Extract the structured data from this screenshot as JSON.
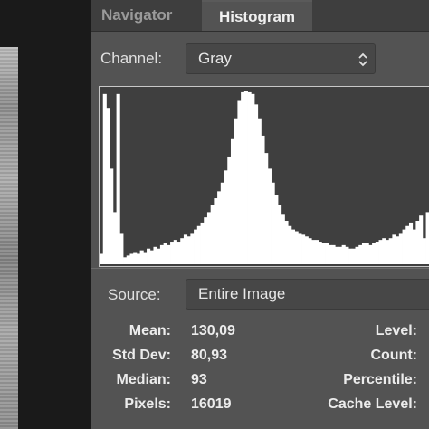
{
  "tabs": [
    {
      "label": "Navigator",
      "active": false
    },
    {
      "label": "Histogram",
      "active": true
    }
  ],
  "channel": {
    "label": "Channel:",
    "value": "Gray"
  },
  "source": {
    "label": "Source:",
    "value": "Entire Image"
  },
  "stats_left": [
    {
      "label": "Mean:",
      "value": "130,09"
    },
    {
      "label": "Std Dev:",
      "value": "80,93"
    },
    {
      "label": "Median:",
      "value": "93"
    },
    {
      "label": "Pixels:",
      "value": "16019"
    }
  ],
  "stats_right": [
    {
      "label": "Level:"
    },
    {
      "label": "Count:"
    },
    {
      "label": "Percentile:"
    },
    {
      "label": "Cache Level:"
    }
  ],
  "colors": {
    "panel": "#535353",
    "tabbar": "#3e3e3e",
    "histogram_bg": "#3f3f3f",
    "histogram_fill": "#ffffff",
    "text": "#ececec"
  },
  "histogram_levels": [
    0.06,
    0.98,
    0.9,
    0.55,
    0.3,
    0.98,
    0.18,
    0.04,
    0.05,
    0.06,
    0.07,
    0.06,
    0.08,
    0.07,
    0.09,
    0.08,
    0.1,
    0.09,
    0.11,
    0.12,
    0.11,
    0.13,
    0.14,
    0.13,
    0.15,
    0.17,
    0.16,
    0.18,
    0.2,
    0.22,
    0.24,
    0.27,
    0.3,
    0.34,
    0.38,
    0.42,
    0.47,
    0.54,
    0.62,
    0.72,
    0.84,
    0.94,
    0.99,
    1.0,
    0.99,
    0.98,
    0.92,
    0.84,
    0.74,
    0.64,
    0.55,
    0.47,
    0.4,
    0.34,
    0.29,
    0.25,
    0.22,
    0.2,
    0.19,
    0.18,
    0.17,
    0.16,
    0.15,
    0.14,
    0.14,
    0.13,
    0.12,
    0.12,
    0.11,
    0.11,
    0.1,
    0.1,
    0.11,
    0.1,
    0.09,
    0.09,
    0.1,
    0.11,
    0.12,
    0.12,
    0.11,
    0.12,
    0.13,
    0.14,
    0.15,
    0.14,
    0.15,
    0.17,
    0.16,
    0.18,
    0.2,
    0.22,
    0.24,
    0.2,
    0.25,
    0.28,
    0.15,
    0.3,
    0.32
  ]
}
